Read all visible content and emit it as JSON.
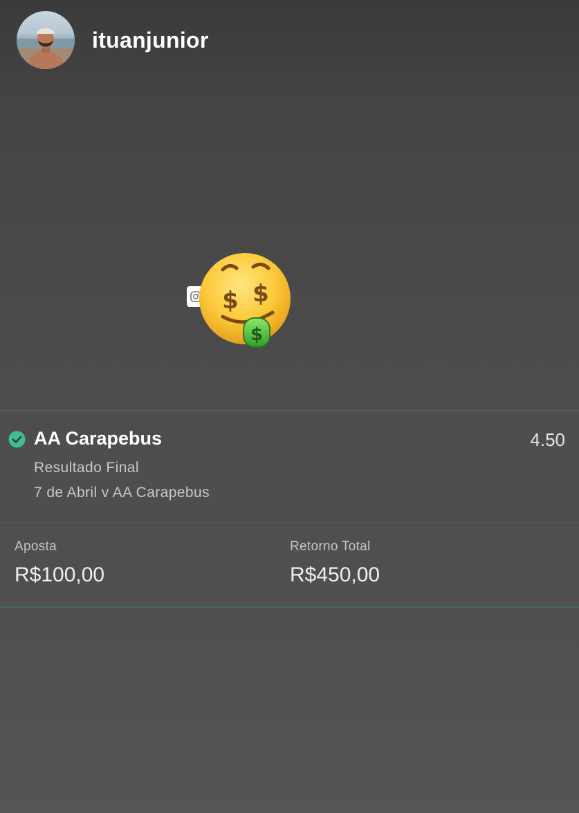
{
  "story": {
    "username": "ituanjunior"
  },
  "sticker": {
    "emoji": "money-mouth-face",
    "badge_icon": "instagram-icon"
  },
  "bet": {
    "selection": "AA Carapebus",
    "odds": "4.50",
    "market": "Resultado Final",
    "event": "7 de Abril v AA Carapebus",
    "status_icon": "check-circle-icon",
    "status_color": "#3dbf8f"
  },
  "stake": {
    "label": "Aposta",
    "value": "R$100,00"
  },
  "return": {
    "label": "Retorno Total",
    "value": "R$450,00"
  },
  "colors": {
    "accent_green": "#3dbf8f"
  }
}
